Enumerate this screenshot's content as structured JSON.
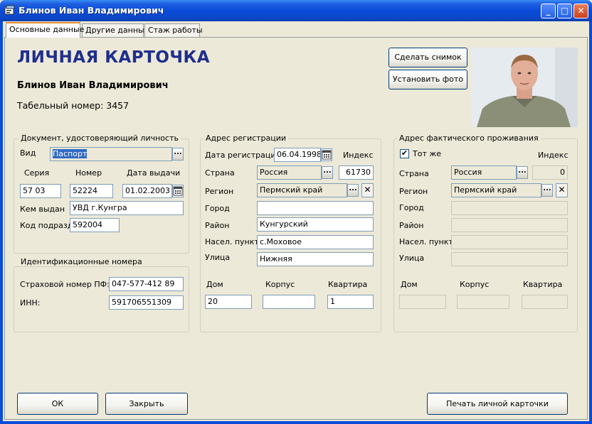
{
  "window": {
    "title": "Блинов Иван Владимирович",
    "controls": {
      "minimize": "_",
      "maximize": "□",
      "close": "✕"
    }
  },
  "tabs": [
    {
      "label": "Основные данные",
      "active": true
    },
    {
      "label": "Другие данные",
      "active": false
    },
    {
      "label": "Стаж работы",
      "active": false
    }
  ],
  "header": {
    "title": "ЛИЧНАЯ КАРТОЧКА",
    "full_name": "Блинов Иван Владимирович",
    "tabnum_label": "Табельный номер:",
    "tabnum_value": "3457",
    "snapshot_button": "Сделать снимок",
    "set_photo_button": "Установить фото"
  },
  "document": {
    "legend": "Документ, удостоверяющий личность",
    "type_label": "Вид",
    "type_value": "Паспорт",
    "series_label": "Серия",
    "number_label": "Номер",
    "issue_date_label": "Дата выдачи",
    "series_value": "57 03",
    "number_value": "52224",
    "issue_date_value": "01.02.2003",
    "issued_by_label": "Кем выдан",
    "issued_by_value": "УВД г.Кунгра",
    "dept_code_label": "Код подразд.",
    "dept_code_value": "592004"
  },
  "ids": {
    "legend": "Идентификационные номера",
    "pension_label": "Страховой номер ПФ:",
    "pension_value": "047-577-412 89",
    "inn_label": "ИНН:",
    "inn_value": "591706551309"
  },
  "registration": {
    "legend": "Адрес регистрации",
    "date_label": "Дата регистрации",
    "date_value": "06.04.1998",
    "index_label": "Индекс",
    "country_label": "Страна",
    "country_value": "Россия",
    "index_value": "61730",
    "region_label": "Регион",
    "region_value": "Пермский край",
    "city_label": "Город",
    "city_value": "",
    "district_label": "Район",
    "district_value": "Кунгурский",
    "settlement_label": "Насел. пункт",
    "settlement_value": "с.Моховое",
    "street_label": "Улица",
    "street_value": "Нижняя",
    "house_label": "Дом",
    "building_label": "Корпус",
    "apartment_label": "Квартира",
    "house_value": "20",
    "building_value": "",
    "apartment_value": "1"
  },
  "actual": {
    "legend": "Адрес фактического проживания",
    "same_label": "Тот же",
    "same_checked": true,
    "index_label": "Индекс",
    "country_label": "Страна",
    "country_value": "Россия",
    "index_value": "0",
    "region_label": "Регион",
    "region_value": "Пермский край",
    "city_label": "Город",
    "district_label": "Район",
    "settlement_label": "Насел. пункт",
    "street_label": "Улица",
    "house_label": "Дом",
    "building_label": "Корпус",
    "apartment_label": "Квартира"
  },
  "footer": {
    "ok_button": "ОК",
    "close_button": "Закрыть",
    "print_button": "Печать личной карточки"
  },
  "colors": {
    "title_blue": "#1F2E8C",
    "titlebar": "#0A4BD8",
    "background": "#ECE9D8",
    "selection": "#316AC5"
  }
}
